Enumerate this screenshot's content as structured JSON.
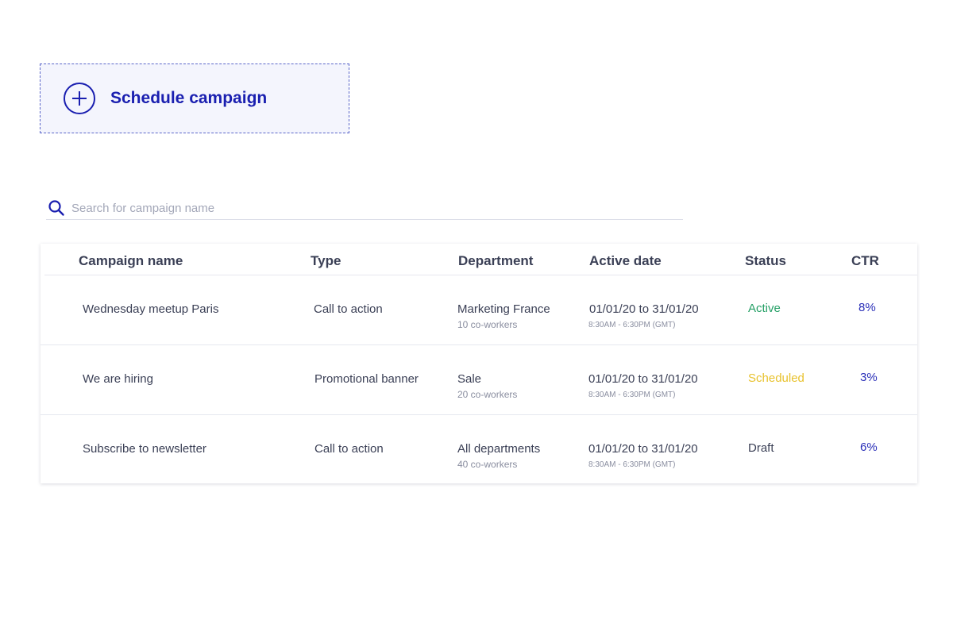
{
  "schedule": {
    "label": "Schedule campaign",
    "accent": "#1a1fb0"
  },
  "search": {
    "placeholder": "Search for campaign name",
    "value": ""
  },
  "table": {
    "headers": {
      "name": "Campaign name",
      "type": "Type",
      "department": "Department",
      "date": "Active date",
      "status": "Status",
      "ctr": "CTR"
    },
    "rows": [
      {
        "name": "Wednesday meetup Paris",
        "type": "Call to action",
        "department": "Marketing France",
        "coworkers": "10 co-workers",
        "date": "01/01/20 to 31/01/20",
        "time": "8:30AM - 6:30PM (GMT)",
        "status": "Active",
        "status_color": "#25a066",
        "ctr": "8%"
      },
      {
        "name": "We are hiring",
        "type": "Promotional banner",
        "department": "Sale",
        "coworkers": "20 co-workers",
        "date": "01/01/20 to 31/01/20",
        "time": "8:30AM - 6:30PM (GMT)",
        "status": "Scheduled",
        "status_color": "#e8c22e",
        "ctr": "3%"
      },
      {
        "name": "Subscribe to newsletter",
        "type": "Call to action",
        "department": "All departments",
        "coworkers": "40 co-workers",
        "date": "01/01/20 to 31/01/20",
        "time": "8:30AM - 6:30PM (GMT)",
        "status": "Draft",
        "status_color": "#3a3f55",
        "ctr": "6%"
      }
    ]
  }
}
